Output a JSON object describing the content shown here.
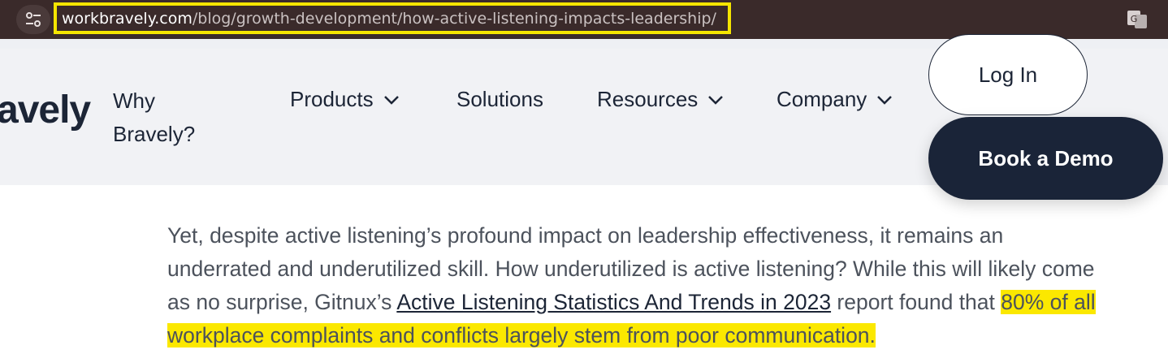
{
  "browser": {
    "url_domain": "workbravely.com",
    "url_path": "/blog/growth-development/how-active-listening-impacts-leadership/",
    "icons": [
      "site-info-icon",
      "translate-icon"
    ],
    "highlight_color": "#f5e500"
  },
  "nav": {
    "logo": "avely",
    "why": "Why Bravely?",
    "products": "Products",
    "solutions": "Solutions",
    "resources": "Resources",
    "company": "Company",
    "login": "Log In",
    "demo": "Book a Demo"
  },
  "article": {
    "text_before_link": "Yet, despite active listening’s profound impact on leadership effectiveness, it remains an underrated and underutilized skill. How underutilized is active listening? While this will likely come as no surprise, Gitnux’s ",
    "link_text": "Active Listening Statistics And Trends in 2023",
    "text_after_link": " report found that ",
    "highlighted_text": "80% of all workplace complaints and conflicts largely stem from poor communication.",
    "highlight_color": "#fbe800"
  }
}
